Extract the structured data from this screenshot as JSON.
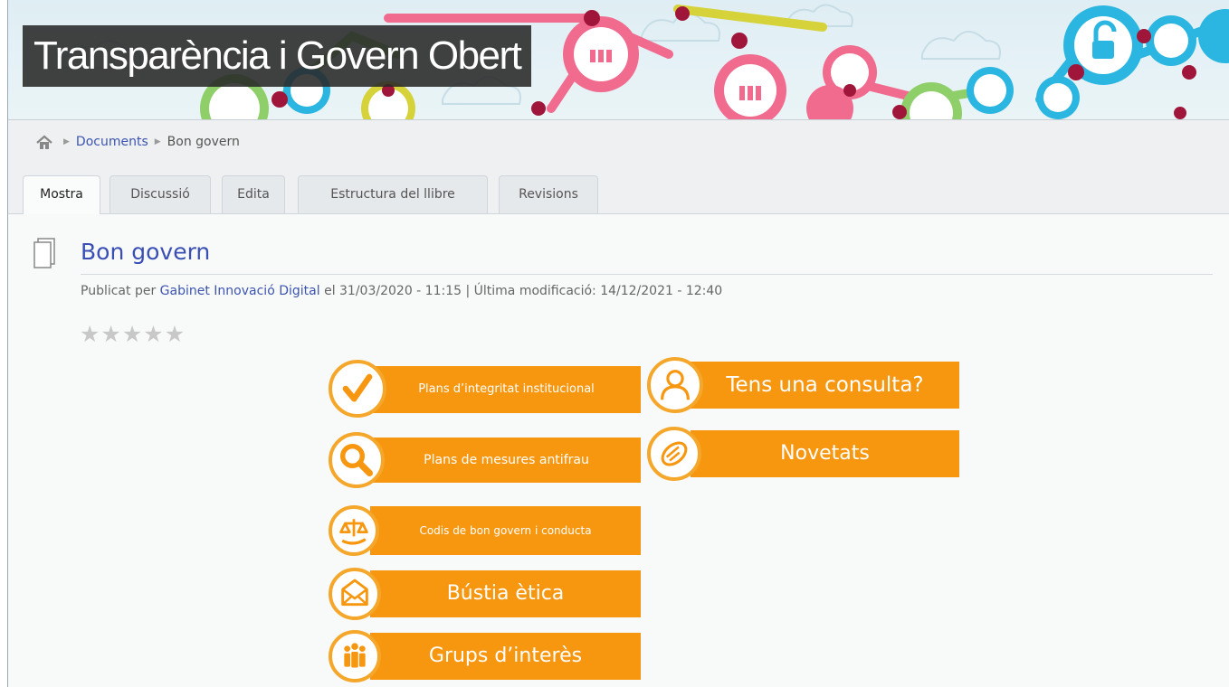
{
  "header": {
    "site_title": "Transparència i Govern Obert"
  },
  "breadcrumb": {
    "home_icon": "home-icon",
    "items": [
      "Documents",
      "Bon govern"
    ]
  },
  "tabs": [
    {
      "label": "Mostra",
      "active": true
    },
    {
      "label": "Discussió",
      "active": false
    },
    {
      "label": "Edita",
      "active": false
    },
    {
      "label": "Estructura del llibre",
      "active": false
    },
    {
      "label": "Revisions",
      "active": false
    }
  ],
  "page": {
    "icon": "document-icon",
    "title": "Bon govern",
    "meta_prefix": "Publicat per",
    "author": "Gabinet Innovació Digital",
    "meta_rest": " el 31/03/2020 - 11:15 | Última modificació: 14/12/2021 - 12:40",
    "rating": {
      "value": 0,
      "max": 5
    }
  },
  "links": [
    {
      "label": "Plans d’integritat institucional",
      "icon": "checkmark-icon"
    },
    {
      "label": "Plans de mesures antifrau",
      "icon": "magnifier-icon"
    },
    {
      "label": "Codis de bon govern i conducta",
      "icon": "scales-hand-icon"
    },
    {
      "label": "Bústia ètica",
      "icon": "envelope-icon"
    },
    {
      "label": "Grups d’interès",
      "icon": "group-people-icon"
    },
    {
      "label": "Tens una consulta?",
      "icon": "person-icon"
    },
    {
      "label": "Novetats",
      "icon": "newspaper-icon"
    }
  ],
  "colors": {
    "orange": "#f7960f",
    "orange_light": "#f4a72a",
    "link_blue": "#3a4fb5",
    "title_overlay": "#282828"
  }
}
